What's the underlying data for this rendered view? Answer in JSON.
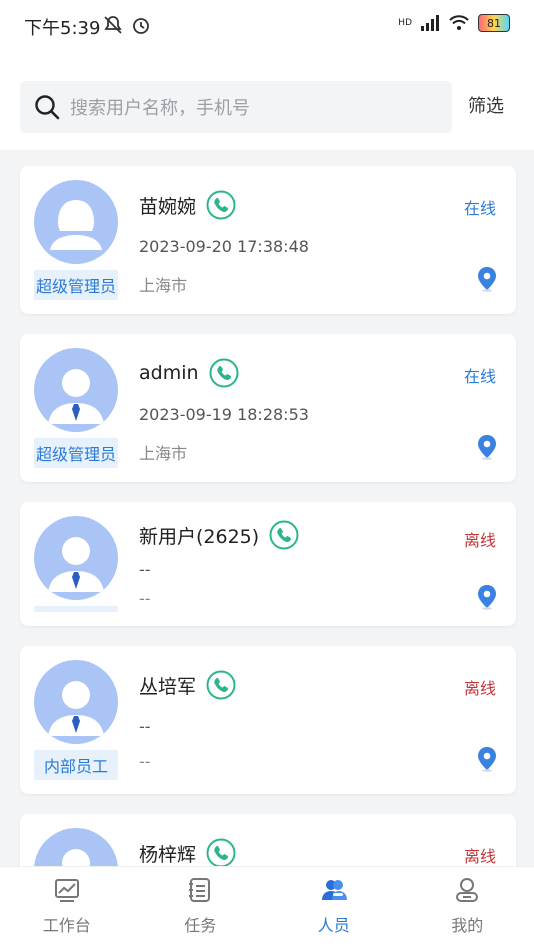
{
  "status_bar": {
    "time": "下午5:39",
    "network": "HD",
    "battery": "81"
  },
  "search": {
    "placeholder": "搜索用户名称，手机号",
    "filter_label": "筛选"
  },
  "users": [
    {
      "name": "苗婉婉",
      "status": "在线",
      "time": "2023-09-20 17:38:48",
      "city": "上海市",
      "role": "超级管理员",
      "online": true
    },
    {
      "name": "admin",
      "status": "在线",
      "time": "2023-09-19 18:28:53",
      "city": "上海市",
      "role": "超级管理员",
      "online": true
    },
    {
      "name": "新用户(2625)",
      "status": "离线",
      "time": "--",
      "city": "--",
      "role": "",
      "online": false
    },
    {
      "name": "丛培军",
      "status": "离线",
      "time": "--",
      "city": "--",
      "role": "内部员工",
      "online": false
    },
    {
      "name": "杨梓辉",
      "status": "离线",
      "time": "",
      "city": "",
      "role": "",
      "online": false
    }
  ],
  "tabs": [
    {
      "label": "工作台",
      "icon": "chart-icon"
    },
    {
      "label": "任务",
      "icon": "tasks-icon"
    },
    {
      "label": "人员",
      "icon": "people-icon"
    },
    {
      "label": "我的",
      "icon": "profile-icon"
    }
  ],
  "colors": {
    "accent": "#2a7bd6",
    "online": "#2a7bd6",
    "offline": "#c2353a",
    "phone_green": "#2bb58c",
    "avatar_bg": "#a9c4f5"
  }
}
